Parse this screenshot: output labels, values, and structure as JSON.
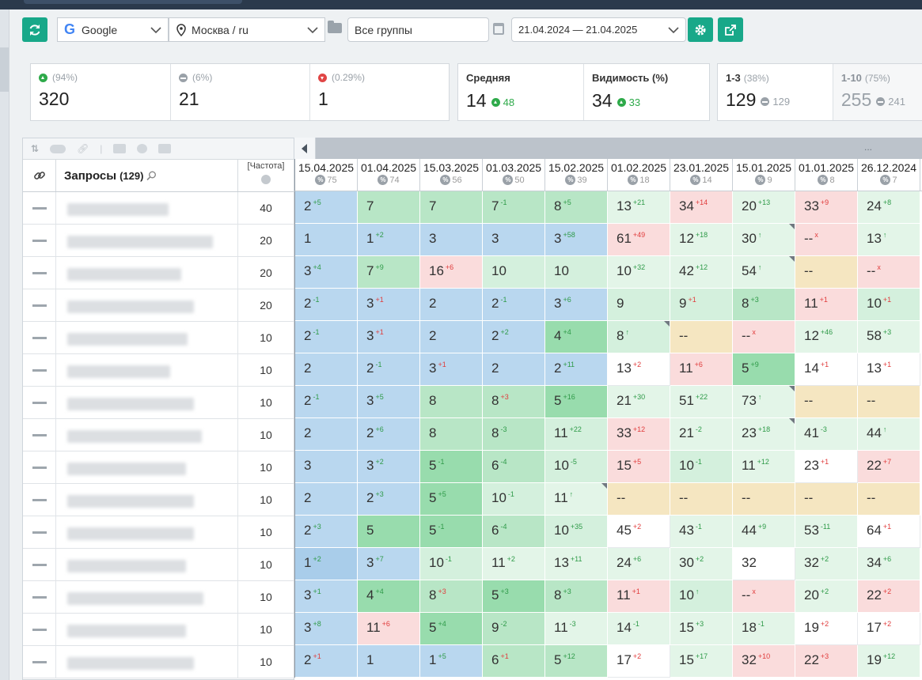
{
  "toolbar": {
    "engine": "Google",
    "engine_logo": "G",
    "region": "Москва / ru",
    "groups": "Все группы",
    "date_range": "21.04.2024 — 21.04.2025"
  },
  "stats_positions": [
    {
      "pct": "(94%)",
      "value": "320",
      "trend": "up"
    },
    {
      "pct": "(6%)",
      "value": "21",
      "trend": "flat"
    },
    {
      "pct": "(0.29%)",
      "value": "1",
      "trend": "down"
    }
  ],
  "stats_avg": [
    {
      "label": "Средняя",
      "value": "14",
      "delta": "48"
    },
    {
      "label": "Видимость (%)",
      "value": "34",
      "delta": "33"
    }
  ],
  "stats_top": [
    {
      "label": "1-3",
      "pct": "(38%)",
      "value": "129",
      "delta": "129"
    },
    {
      "label": "1-10",
      "pct": "(75%)",
      "value": "255",
      "delta": "241"
    }
  ],
  "table": {
    "queries_label": "Запросы",
    "queries_count": "(129)",
    "freq_label": "[Частота]",
    "more": "...",
    "frequencies": [
      "40",
      "20",
      "20",
      "20",
      "10",
      "10",
      "10",
      "10",
      "10",
      "10",
      "10",
      "10",
      "10",
      "10",
      "10"
    ],
    "dates": [
      {
        "d": "15.04.2025",
        "n": "75"
      },
      {
        "d": "01.04.2025",
        "n": "74"
      },
      {
        "d": "15.03.2025",
        "n": "56"
      },
      {
        "d": "01.03.2025",
        "n": "50"
      },
      {
        "d": "15.02.2025",
        "n": "39"
      },
      {
        "d": "01.02.2025",
        "n": "18"
      },
      {
        "d": "23.01.2025",
        "n": "14"
      },
      {
        "d": "15.01.2025",
        "n": "9"
      },
      {
        "d": "01.01.2025",
        "n": "8"
      },
      {
        "d": "26.12.2024",
        "n": "7"
      }
    ],
    "rows": [
      [
        [
          "2",
          "+5",
          "up",
          "blue"
        ],
        [
          "7",
          "",
          "",
          "g2"
        ],
        [
          "7",
          "",
          "",
          "g2"
        ],
        [
          "7",
          "-1",
          "up",
          "g2"
        ],
        [
          "8",
          "+5",
          "up",
          "g2"
        ],
        [
          "13",
          "+21",
          "up",
          "g4"
        ],
        [
          "34",
          "+14",
          "dn",
          "pink"
        ],
        [
          "20",
          "+13",
          "up",
          "g4"
        ],
        [
          "33",
          "+9",
          "dn",
          "pink"
        ],
        [
          "24",
          "+8",
          "up",
          "g4"
        ]
      ],
      [
        [
          "1",
          "",
          "",
          "blue"
        ],
        [
          "1",
          "+2",
          "up",
          "blue"
        ],
        [
          "3",
          "",
          "",
          "blue"
        ],
        [
          "3",
          "",
          "",
          "blue"
        ],
        [
          "3",
          "+58",
          "up",
          "blue"
        ],
        [
          "61",
          "+49",
          "dn",
          "pink"
        ],
        [
          "12",
          "+18",
          "up",
          "g4"
        ],
        [
          "30",
          "↑",
          "up",
          "g4",
          1
        ],
        [
          "--",
          "x",
          "dn",
          "pink"
        ],
        [
          "13",
          "↑",
          "up",
          "g4"
        ]
      ],
      [
        [
          "3",
          "+4",
          "up",
          "blue"
        ],
        [
          "7",
          "+9",
          "up",
          "g2"
        ],
        [
          "16",
          "+6",
          "dn",
          "pink"
        ],
        [
          "10",
          "",
          "",
          "g1"
        ],
        [
          "10",
          "",
          "",
          "g1"
        ],
        [
          "10",
          "+32",
          "up",
          "g4"
        ],
        [
          "42",
          "+12",
          "up",
          "g4"
        ],
        [
          "54",
          "↑",
          "up",
          "g4",
          1
        ],
        [
          "--",
          "",
          "",
          "y"
        ],
        [
          "--",
          "x",
          "dn",
          "pink"
        ]
      ],
      [
        [
          "2",
          "-1",
          "up",
          "blue"
        ],
        [
          "3",
          "+1",
          "dn",
          "blue"
        ],
        [
          "2",
          "",
          "",
          "blue"
        ],
        [
          "2",
          "-1",
          "up",
          "blue"
        ],
        [
          "3",
          "+6",
          "up",
          "blue"
        ],
        [
          "9",
          "",
          "",
          "g1"
        ],
        [
          "9",
          "+1",
          "dn",
          "g1"
        ],
        [
          "8",
          "+3",
          "up",
          "g2"
        ],
        [
          "11",
          "+1",
          "dn",
          "pink"
        ],
        [
          "10",
          "+1",
          "dn",
          "g1"
        ]
      ],
      [
        [
          "2",
          "-1",
          "up",
          "blue"
        ],
        [
          "3",
          "+1",
          "dn",
          "blue"
        ],
        [
          "2",
          "",
          "",
          "blue"
        ],
        [
          "2",
          "+2",
          "up",
          "blue"
        ],
        [
          "4",
          "+4",
          "up",
          "g3"
        ],
        [
          "8",
          "↑",
          "up",
          "g1",
          1
        ],
        [
          "--",
          "",
          "",
          "y"
        ],
        [
          "--",
          "x",
          "dn",
          "pink"
        ],
        [
          "12",
          "+46",
          "up",
          "g4"
        ],
        [
          "58",
          "+3",
          "up",
          "g4"
        ]
      ],
      [
        [
          "2",
          "",
          "",
          "blue"
        ],
        [
          "2",
          "-1",
          "up",
          "blue"
        ],
        [
          "3",
          "+1",
          "dn",
          "blue"
        ],
        [
          "2",
          "",
          "",
          "blue"
        ],
        [
          "2",
          "+11",
          "up",
          "blue"
        ],
        [
          "13",
          "+2",
          "dn",
          "w"
        ],
        [
          "11",
          "+6",
          "dn",
          "pink"
        ],
        [
          "5",
          "+9",
          "up",
          "g3"
        ],
        [
          "14",
          "+1",
          "dn",
          "w"
        ],
        [
          "13",
          "+1",
          "dn",
          "w"
        ]
      ],
      [
        [
          "2",
          "-1",
          "up",
          "blue"
        ],
        [
          "3",
          "+5",
          "up",
          "blue"
        ],
        [
          "8",
          "",
          "",
          "g2"
        ],
        [
          "8",
          "+3",
          "dn",
          "g2"
        ],
        [
          "5",
          "+16",
          "up",
          "g3"
        ],
        [
          "21",
          "+30",
          "up",
          "g4"
        ],
        [
          "51",
          "+22",
          "up",
          "g4"
        ],
        [
          "73",
          "↑",
          "up",
          "g4",
          1
        ],
        [
          "--",
          "",
          "",
          "y"
        ],
        [
          "--",
          "",
          "",
          "y"
        ]
      ],
      [
        [
          "2",
          "",
          "",
          "blue"
        ],
        [
          "2",
          "+6",
          "up",
          "blue"
        ],
        [
          "8",
          "",
          "",
          "g2"
        ],
        [
          "8",
          "-3",
          "up",
          "g2"
        ],
        [
          "11",
          "+22",
          "up",
          "g1"
        ],
        [
          "33",
          "+12",
          "dn",
          "pink"
        ],
        [
          "21",
          "-2",
          "up",
          "g4"
        ],
        [
          "23",
          "+18",
          "up",
          "g4",
          1
        ],
        [
          "41",
          "-3",
          "up",
          "g4"
        ],
        [
          "44",
          "↑",
          "up",
          "g4"
        ]
      ],
      [
        [
          "3",
          "",
          "",
          "blue"
        ],
        [
          "3",
          "+2",
          "up",
          "blue"
        ],
        [
          "5",
          "-1",
          "up",
          "g3"
        ],
        [
          "6",
          "-4",
          "up",
          "g2"
        ],
        [
          "10",
          "-5",
          "up",
          "g1"
        ],
        [
          "15",
          "+5",
          "dn",
          "pink"
        ],
        [
          "10",
          "-1",
          "up",
          "g1"
        ],
        [
          "11",
          "+12",
          "up",
          "g4"
        ],
        [
          "23",
          "+1",
          "dn",
          "w"
        ],
        [
          "22",
          "+7",
          "dn",
          "pink"
        ]
      ],
      [
        [
          "2",
          "",
          "",
          "blue"
        ],
        [
          "2",
          "+3",
          "up",
          "blue"
        ],
        [
          "5",
          "+5",
          "up",
          "g3"
        ],
        [
          "10",
          "-1",
          "up",
          "g1"
        ],
        [
          "11",
          "↑",
          "up",
          "g4",
          1
        ],
        [
          "--",
          "",
          "",
          "y"
        ],
        [
          "--",
          "",
          "",
          "y"
        ],
        [
          "--",
          "",
          "",
          "y"
        ],
        [
          "--",
          "",
          "",
          "y"
        ],
        [
          "--",
          "",
          "",
          "y"
        ]
      ],
      [
        [
          "2",
          "+3",
          "up",
          "blue"
        ],
        [
          "5",
          "",
          "",
          "g3"
        ],
        [
          "5",
          "-1",
          "up",
          "g3"
        ],
        [
          "6",
          "-4",
          "up",
          "g2"
        ],
        [
          "10",
          "+35",
          "up",
          "g1"
        ],
        [
          "45",
          "+2",
          "dn",
          "w"
        ],
        [
          "43",
          "-1",
          "up",
          "g4"
        ],
        [
          "44",
          "+9",
          "up",
          "g4"
        ],
        [
          "53",
          "-11",
          "up",
          "g4"
        ],
        [
          "64",
          "+1",
          "dn",
          "w"
        ]
      ],
      [
        [
          "1",
          "+2",
          "up",
          "blue2"
        ],
        [
          "3",
          "+7",
          "up",
          "blue"
        ],
        [
          "10",
          "-1",
          "up",
          "g1"
        ],
        [
          "11",
          "+2",
          "up",
          "g4"
        ],
        [
          "13",
          "+11",
          "up",
          "g4"
        ],
        [
          "24",
          "+6",
          "up",
          "g4"
        ],
        [
          "30",
          "+2",
          "up",
          "g4"
        ],
        [
          "32",
          "",
          "",
          "w"
        ],
        [
          "32",
          "+2",
          "up",
          "g4"
        ],
        [
          "34",
          "+6",
          "up",
          "g4"
        ]
      ],
      [
        [
          "3",
          "+1",
          "up",
          "blue"
        ],
        [
          "4",
          "+4",
          "up",
          "g3"
        ],
        [
          "8",
          "+3",
          "dn",
          "g2"
        ],
        [
          "5",
          "+3",
          "up",
          "g3"
        ],
        [
          "8",
          "+3",
          "up",
          "g2"
        ],
        [
          "11",
          "+1",
          "dn",
          "pink"
        ],
        [
          "10",
          "↑",
          "up",
          "g1"
        ],
        [
          "--",
          "x",
          "dn",
          "pink"
        ],
        [
          "20",
          "+2",
          "up",
          "g4"
        ],
        [
          "22",
          "+2",
          "dn",
          "pink"
        ]
      ],
      [
        [
          "3",
          "+8",
          "up",
          "blue"
        ],
        [
          "11",
          "+6",
          "dn",
          "pink"
        ],
        [
          "5",
          "+4",
          "up",
          "g3"
        ],
        [
          "9",
          "-2",
          "up",
          "g2"
        ],
        [
          "11",
          "-3",
          "up",
          "g4"
        ],
        [
          "14",
          "-1",
          "up",
          "g4"
        ],
        [
          "15",
          "+3",
          "up",
          "g4"
        ],
        [
          "18",
          "-1",
          "up",
          "g4"
        ],
        [
          "19",
          "+2",
          "dn",
          "w"
        ],
        [
          "17",
          "+2",
          "dn",
          "w"
        ]
      ],
      [
        [
          "2",
          "+1",
          "dn",
          "blue"
        ],
        [
          "1",
          "",
          "",
          "blue"
        ],
        [
          "1",
          "+5",
          "up",
          "blue"
        ],
        [
          "6",
          "+1",
          "dn",
          "g2"
        ],
        [
          "5",
          "+12",
          "up",
          "g2"
        ],
        [
          "17",
          "+2",
          "dn",
          "w"
        ],
        [
          "15",
          "+17",
          "up",
          "g4"
        ],
        [
          "32",
          "+10",
          "dn",
          "pink"
        ],
        [
          "22",
          "+3",
          "dn",
          "pink"
        ],
        [
          "19",
          "+12",
          "up",
          "g4"
        ]
      ]
    ]
  },
  "colors": {
    "accent": "#18a889",
    "up": "#2e9a48",
    "down": "#e03c3c"
  }
}
